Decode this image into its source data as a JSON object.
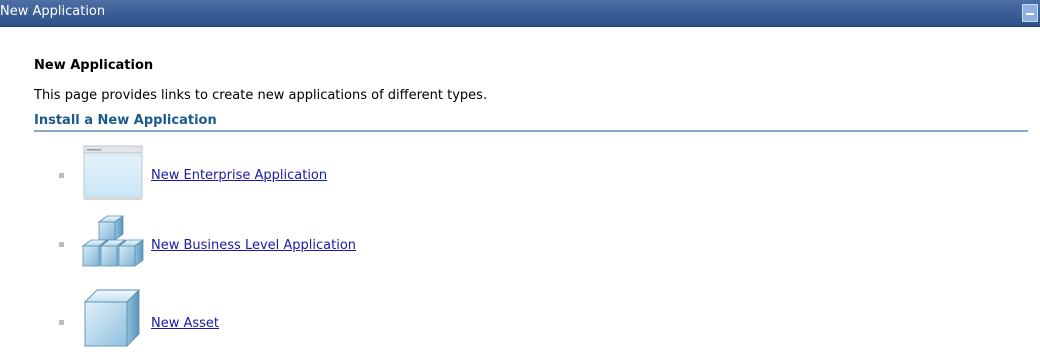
{
  "window": {
    "title": "New Application"
  },
  "page": {
    "heading": "New Application",
    "description": "This page provides links to create new applications of different types."
  },
  "section": {
    "title": "Install a New Application"
  },
  "items": [
    {
      "label": "New Enterprise Application",
      "icon": "window-icon"
    },
    {
      "label": "New Business Level Application",
      "icon": "stacked-cubes-icon"
    },
    {
      "label": "New Asset",
      "icon": "cube-icon"
    }
  ],
  "colors": {
    "titlebar": "#3a5e96",
    "link": "#1a1aa6",
    "section_title": "#1a5a8c",
    "section_rule": "#8aa7c2"
  }
}
